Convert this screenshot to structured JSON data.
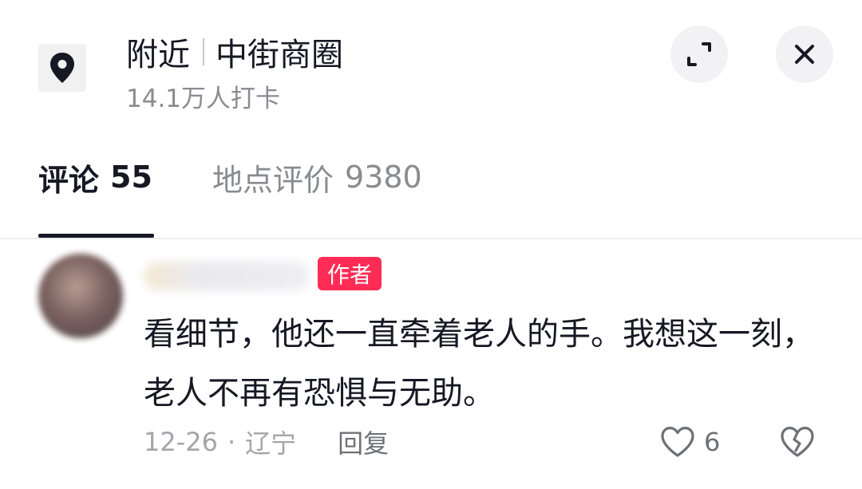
{
  "header": {
    "nearby_label": "附近",
    "place_name": "中街商圈",
    "checkins": "14.1万人打卡",
    "location_icon": "location-pin-icon",
    "expand_icon": "expand-icon",
    "close_icon": "close-icon"
  },
  "tabs": [
    {
      "label": "评论",
      "count": "55",
      "active": true
    },
    {
      "label": "地点评价",
      "count": "9380",
      "active": false
    }
  ],
  "comment": {
    "badge": "作者",
    "text": "看细节，他还一直牵着老人的手。我想这一刻，老人不再有恐惧与无助。",
    "date": "12-26",
    "separator": "·",
    "region": "辽宁",
    "reply_label": "回复",
    "likes": "6",
    "like_icon": "heart-outline-icon",
    "dislike_icon": "broken-heart-icon"
  },
  "colors": {
    "badge_bg": "#fe2c55",
    "text_primary": "#161823",
    "text_secondary": "#8a8b91"
  }
}
